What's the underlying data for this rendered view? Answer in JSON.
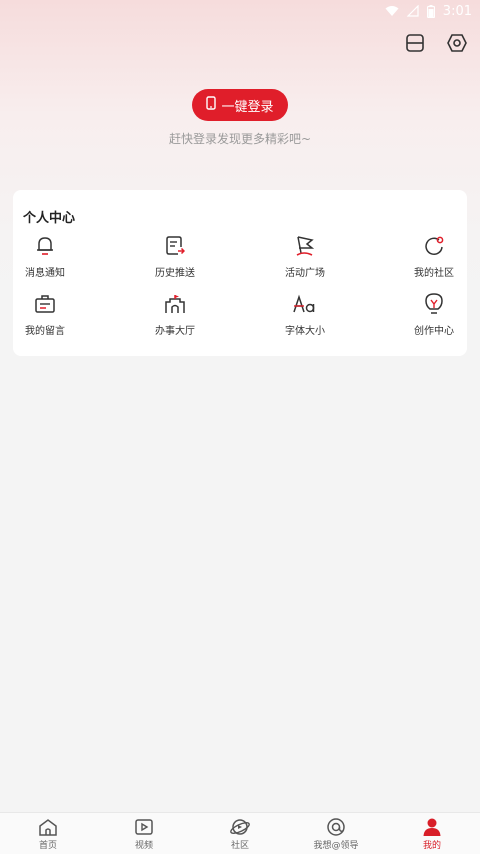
{
  "status_bar": {
    "time": "3:01"
  },
  "colors": {
    "accent": "#e01e2a",
    "text": "#222222",
    "subtle": "#9a9a9a"
  },
  "header": {
    "icons": [
      "scan-icon",
      "settings-icon"
    ]
  },
  "login": {
    "button_label": "一键登录",
    "subtitle": "赶快登录发现更多精彩吧~"
  },
  "personal_center": {
    "title": "个人中心",
    "items": [
      {
        "label": "消息通知",
        "icon": "bell-icon"
      },
      {
        "label": "历史推送",
        "icon": "history-doc-icon"
      },
      {
        "label": "活动广场",
        "icon": "flag-icon"
      },
      {
        "label": "我的社区",
        "icon": "community-icon"
      },
      {
        "label": "我的留言",
        "icon": "message-box-icon"
      },
      {
        "label": "办事大厅",
        "icon": "hall-icon"
      },
      {
        "label": "字体大小",
        "icon": "font-size-icon"
      },
      {
        "label": "创作中心",
        "icon": "bulb-icon"
      }
    ]
  },
  "tabbar": {
    "items": [
      {
        "label": "首页",
        "icon": "home-icon"
      },
      {
        "label": "视频",
        "icon": "video-icon"
      },
      {
        "label": "社区",
        "icon": "planet-icon"
      },
      {
        "label": "我想@领导",
        "icon": "at-icon"
      },
      {
        "label": "我的",
        "icon": "user-icon"
      }
    ],
    "active_index": 4
  }
}
